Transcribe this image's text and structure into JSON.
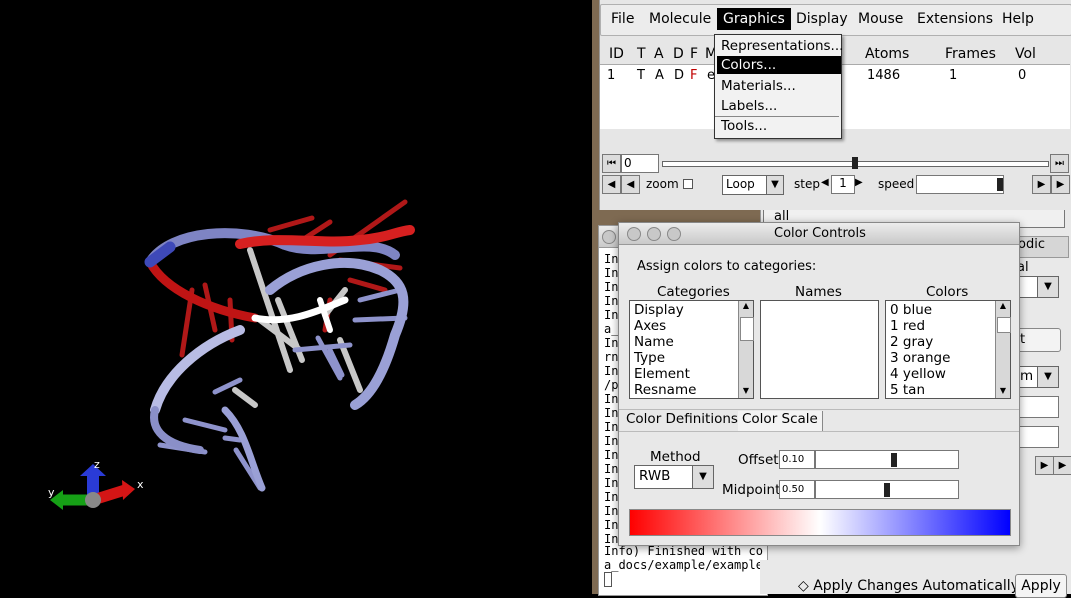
{
  "axes": {
    "x": "x",
    "y": "y",
    "z": "z"
  },
  "main_menu": {
    "items": [
      "File",
      "Molecule",
      "Graphics",
      "Display",
      "Mouse",
      "Extensions",
      "Help"
    ],
    "active": "Graphics"
  },
  "mol_table": {
    "headers": {
      "id": "ID",
      "t": "T",
      "a": "A",
      "d": "D",
      "f": "F",
      "m": "M",
      "atoms": "Atoms",
      "frames": "Frames",
      "vol": "Vol"
    },
    "row": {
      "id": "1",
      "t": "T",
      "a": "A",
      "d": "D",
      "f": "F",
      "name": "e",
      "atoms": "1486",
      "frames": "1",
      "vol": "0"
    }
  },
  "anim": {
    "frame_value": "0",
    "zoom_label": "zoom",
    "loop_value": "Loop",
    "step_label": "step",
    "step_value": "1",
    "speed_label": "speed"
  },
  "graphics_menu": {
    "items": [
      "Representations...",
      "Colors...",
      "Materials...",
      "Labels...",
      "Tools..."
    ],
    "selected": "Colors..."
  },
  "console": {
    "lines": [
      "In",
      "In",
      "In",
      "In",
      "In",
      "a_",
      "In",
      "rn",
      "In",
      "/p",
      "In",
      "In",
      "In",
      "In",
      "In",
      "In",
      "In",
      "In",
      "In",
      "In",
      "In"
    ],
    "footer1": "Info) Finished with co",
    "footer2": "a_docs/example/example"
  },
  "right_window": {
    "selection_text": "all",
    "tab_label": "odic",
    "label_al": "al",
    "label_t": "t",
    "label_m": "m"
  },
  "color_controls": {
    "title": "Color Controls",
    "assign_label": "Assign colors to categories:",
    "headers": {
      "categories": "Categories",
      "names": "Names",
      "colors": "Colors"
    },
    "categories": [
      "Display",
      "Axes",
      "Name",
      "Type",
      "Element",
      "Resname"
    ],
    "colors": [
      "0 blue",
      "1 red",
      "2 gray",
      "3 orange",
      "4 yellow",
      "5 tan"
    ],
    "tabs": [
      "Color Definitions",
      "Color Scale"
    ],
    "method_label": "Method",
    "method_value": "RWB",
    "offset_label": "Offset",
    "offset_value": "0.10",
    "midpoint_label": "Midpoint",
    "midpoint_value": "0.50",
    "scale_colors": [
      "#ff0000",
      "#ffffff",
      "#0000ff"
    ]
  },
  "bottom": {
    "auto_apply_label": "Apply Changes Automatically",
    "apply_label": "Apply"
  }
}
